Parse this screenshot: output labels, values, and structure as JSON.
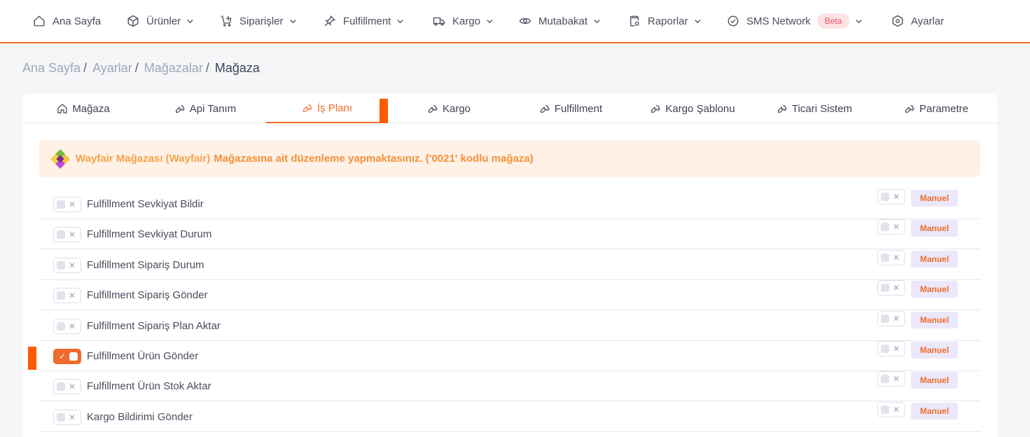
{
  "nav": {
    "items": [
      {
        "label": "Ana Sayfa",
        "icon": "home-icon",
        "has_dropdown": false
      },
      {
        "label": "Ürünler",
        "icon": "box-icon",
        "has_dropdown": true
      },
      {
        "label": "Siparişler",
        "icon": "cart-icon",
        "has_dropdown": true
      },
      {
        "label": "Fulfillment",
        "icon": "pin-icon",
        "has_dropdown": true
      },
      {
        "label": "Kargo",
        "icon": "truck-icon",
        "has_dropdown": true
      },
      {
        "label": "Mutabakat",
        "icon": "eye-icon",
        "has_dropdown": true
      },
      {
        "label": "Raporlar",
        "icon": "clipboard-icon",
        "has_dropdown": true
      },
      {
        "label": "SMS Network",
        "icon": "check-circle-icon",
        "has_dropdown": true,
        "badge": "Beta"
      },
      {
        "label": "Ayarlar",
        "icon": "hexagon-gear-icon",
        "has_dropdown": false
      }
    ],
    "accent": "#f26c2c"
  },
  "breadcrumb": {
    "items": [
      "Ana Sayfa",
      "Ayarlar",
      "Mağazalar"
    ],
    "separator": "/",
    "current": "Mağaza"
  },
  "tabs": [
    {
      "label": "Mağaza",
      "icon": "home-icon",
      "active": false
    },
    {
      "label": "Api Tanım",
      "icon": "wrench-icon",
      "active": false
    },
    {
      "label": "İş Planı",
      "icon": "wrench-icon",
      "active": true
    },
    {
      "label": "Kargo",
      "icon": "wrench-icon",
      "active": false
    },
    {
      "label": "Fulfillment",
      "icon": "wrench-icon",
      "active": false
    },
    {
      "label": "Kargo Şablonu",
      "icon": "wrench-icon",
      "active": false
    },
    {
      "label": "Ticari Sistem",
      "icon": "wrench-icon",
      "active": false
    },
    {
      "label": "Parametre",
      "icon": "wrench-icon",
      "active": false
    }
  ],
  "alert": {
    "store_name": "Wayfair Mağazası (Wayfair)",
    "message": "Mağazasına ait düzenleme yapmaktasınız. ('0021' kodlu mağaza)",
    "logo": "wayfair-logo-icon"
  },
  "jobs": [
    {
      "label": "Fulfillment Sevkiyat Bildir",
      "enabled": false,
      "mode_enabled": false,
      "mode_label": "Manuel"
    },
    {
      "label": "Fulfillment Sevkiyat Durum",
      "enabled": false,
      "mode_enabled": false,
      "mode_label": "Manuel"
    },
    {
      "label": "Fulfillment Sipariş Durum",
      "enabled": false,
      "mode_enabled": false,
      "mode_label": "Manuel"
    },
    {
      "label": "Fulfillment Sipariş Gönder",
      "enabled": false,
      "mode_enabled": false,
      "mode_label": "Manuel"
    },
    {
      "label": "Fulfillment Sipariş Plan Aktar",
      "enabled": false,
      "mode_enabled": false,
      "mode_label": "Manuel"
    },
    {
      "label": "Fulfillment Ürün Gönder",
      "enabled": true,
      "mode_enabled": false,
      "mode_label": "Manuel"
    },
    {
      "label": "Fulfillment Ürün Stok Aktar",
      "enabled": false,
      "mode_enabled": false,
      "mode_label": "Manuel"
    },
    {
      "label": "Kargo Bildirimi Gönder",
      "enabled": false,
      "mode_enabled": false,
      "mode_label": "Manuel"
    }
  ],
  "toggle_glyphs": {
    "off": "✕",
    "on": "✓"
  }
}
